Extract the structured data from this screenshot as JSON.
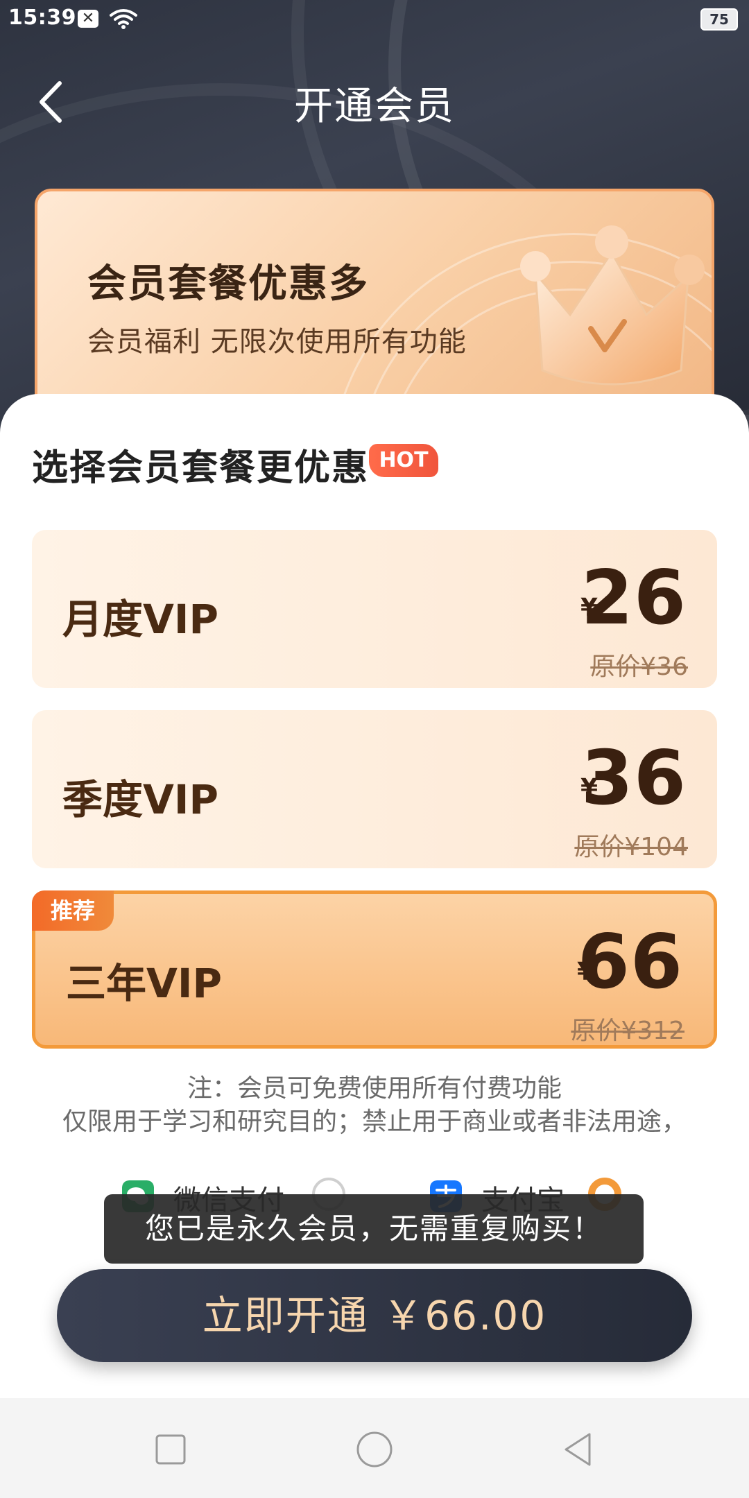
{
  "status_bar": {
    "time": "15:39",
    "msg_icon_glyph": "✕",
    "battery": "75"
  },
  "header": {
    "title": "开通会员"
  },
  "banner": {
    "title": "会员套餐优惠多",
    "subtitle": "会员福利 无限次使用所有功能"
  },
  "section": {
    "title": "选择会员套餐更优惠",
    "hot_badge": "HOT"
  },
  "plans": [
    {
      "name": "月度VIP",
      "currency": "¥",
      "price": "26",
      "original": "原价¥36",
      "selected": false
    },
    {
      "name": "季度VIP",
      "currency": "¥",
      "price": "36",
      "original": "原价¥104",
      "selected": false
    },
    {
      "name": "三年VIP",
      "currency": "¥",
      "price": "66",
      "original": "原价¥312",
      "selected": true,
      "badge": "推荐"
    }
  ],
  "notes": {
    "line1": "注：会员可免费使用所有付费功能",
    "line2": "仅限用于学习和研究目的；禁止用于商业或者非法用途，"
  },
  "payment": {
    "wechat_label": "微信支付",
    "alipay_label": "支付宝",
    "selected": "alipay"
  },
  "toast": {
    "message": "您已是永久会员，无需重复购买！"
  },
  "open_button": {
    "label": "立即开通 ￥66.00"
  },
  "colors": {
    "accent_orange": "#f39a3a",
    "dark_button": "#2e3340",
    "gold_text": "#f7d6ae",
    "wechat_green": "#2aae67",
    "alipay_blue": "#1677ff"
  }
}
